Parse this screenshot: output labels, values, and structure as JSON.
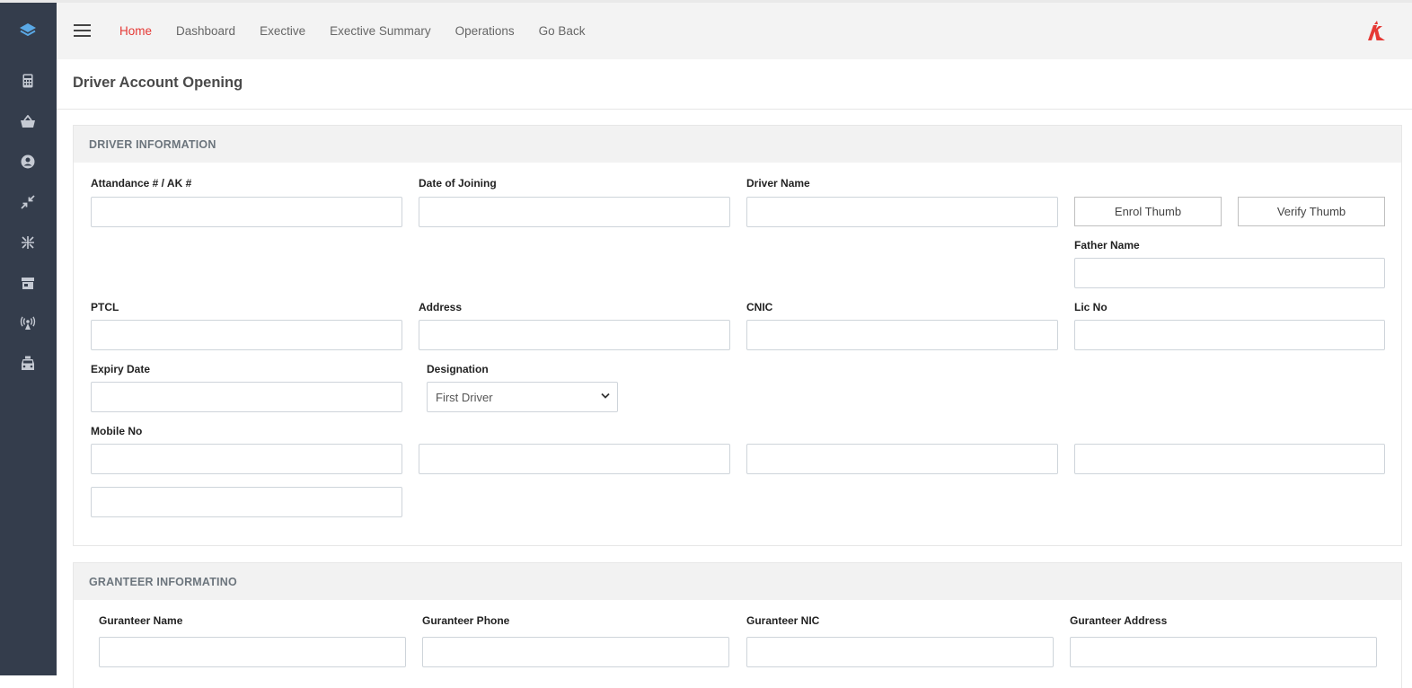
{
  "nav": {
    "items": [
      {
        "label": "Home",
        "active": true
      },
      {
        "label": "Dashboard",
        "active": false
      },
      {
        "label": "Exective",
        "active": false
      },
      {
        "label": "Exective Summary",
        "active": false
      },
      {
        "label": "Operations",
        "active": false
      },
      {
        "label": "Go Back",
        "active": false
      }
    ]
  },
  "sidebar": {
    "icons": [
      "layers-icon",
      "calculator-icon",
      "basket-icon",
      "user-circle-icon",
      "compress-arrows-icon",
      "expand-arrows-icon",
      "store-icon",
      "broadcast-icon",
      "taxi-icon"
    ]
  },
  "colors": {
    "sidebar": "#343d4c",
    "accent": "#e53935",
    "layers_icon": "#5aa9e6"
  },
  "page": {
    "title": "Driver Account Opening"
  },
  "driver_section": {
    "title": "DRIVER INFORMATION",
    "attendance_label": "Attandance # / AK #",
    "attendance_value": "",
    "joining_label": "Date of Joining",
    "joining_value": "",
    "driver_name_label": "Driver Name",
    "driver_name_value": "",
    "enrol_thumb": "Enrol Thumb",
    "verify_thumb": "Verify Thumb",
    "father_name_label": "Father Name",
    "father_name_value": "",
    "ptcl_label": "PTCL",
    "ptcl_value": "",
    "address_label": "Address",
    "address_value": "",
    "cnic_label": "CNIC",
    "cnic_value": "",
    "lic_label": "Lic No",
    "lic_value": "",
    "expiry_label": "Expiry Date",
    "expiry_value": "",
    "designation_label": "Designation",
    "designation_value": "First Driver",
    "mobile_label": "Mobile No",
    "mobile_values": [
      "",
      "",
      "",
      "",
      ""
    ]
  },
  "guarantor_section": {
    "title": "GRANTEER INFORMATINO",
    "name_label": "Guranteer Name",
    "phone_label": "Guranteer Phone",
    "nic_label": "Guranteer NIC",
    "address_label": "Guranteer Address",
    "name_value": "",
    "phone_value": "",
    "nic_value": "",
    "address_value": ""
  }
}
